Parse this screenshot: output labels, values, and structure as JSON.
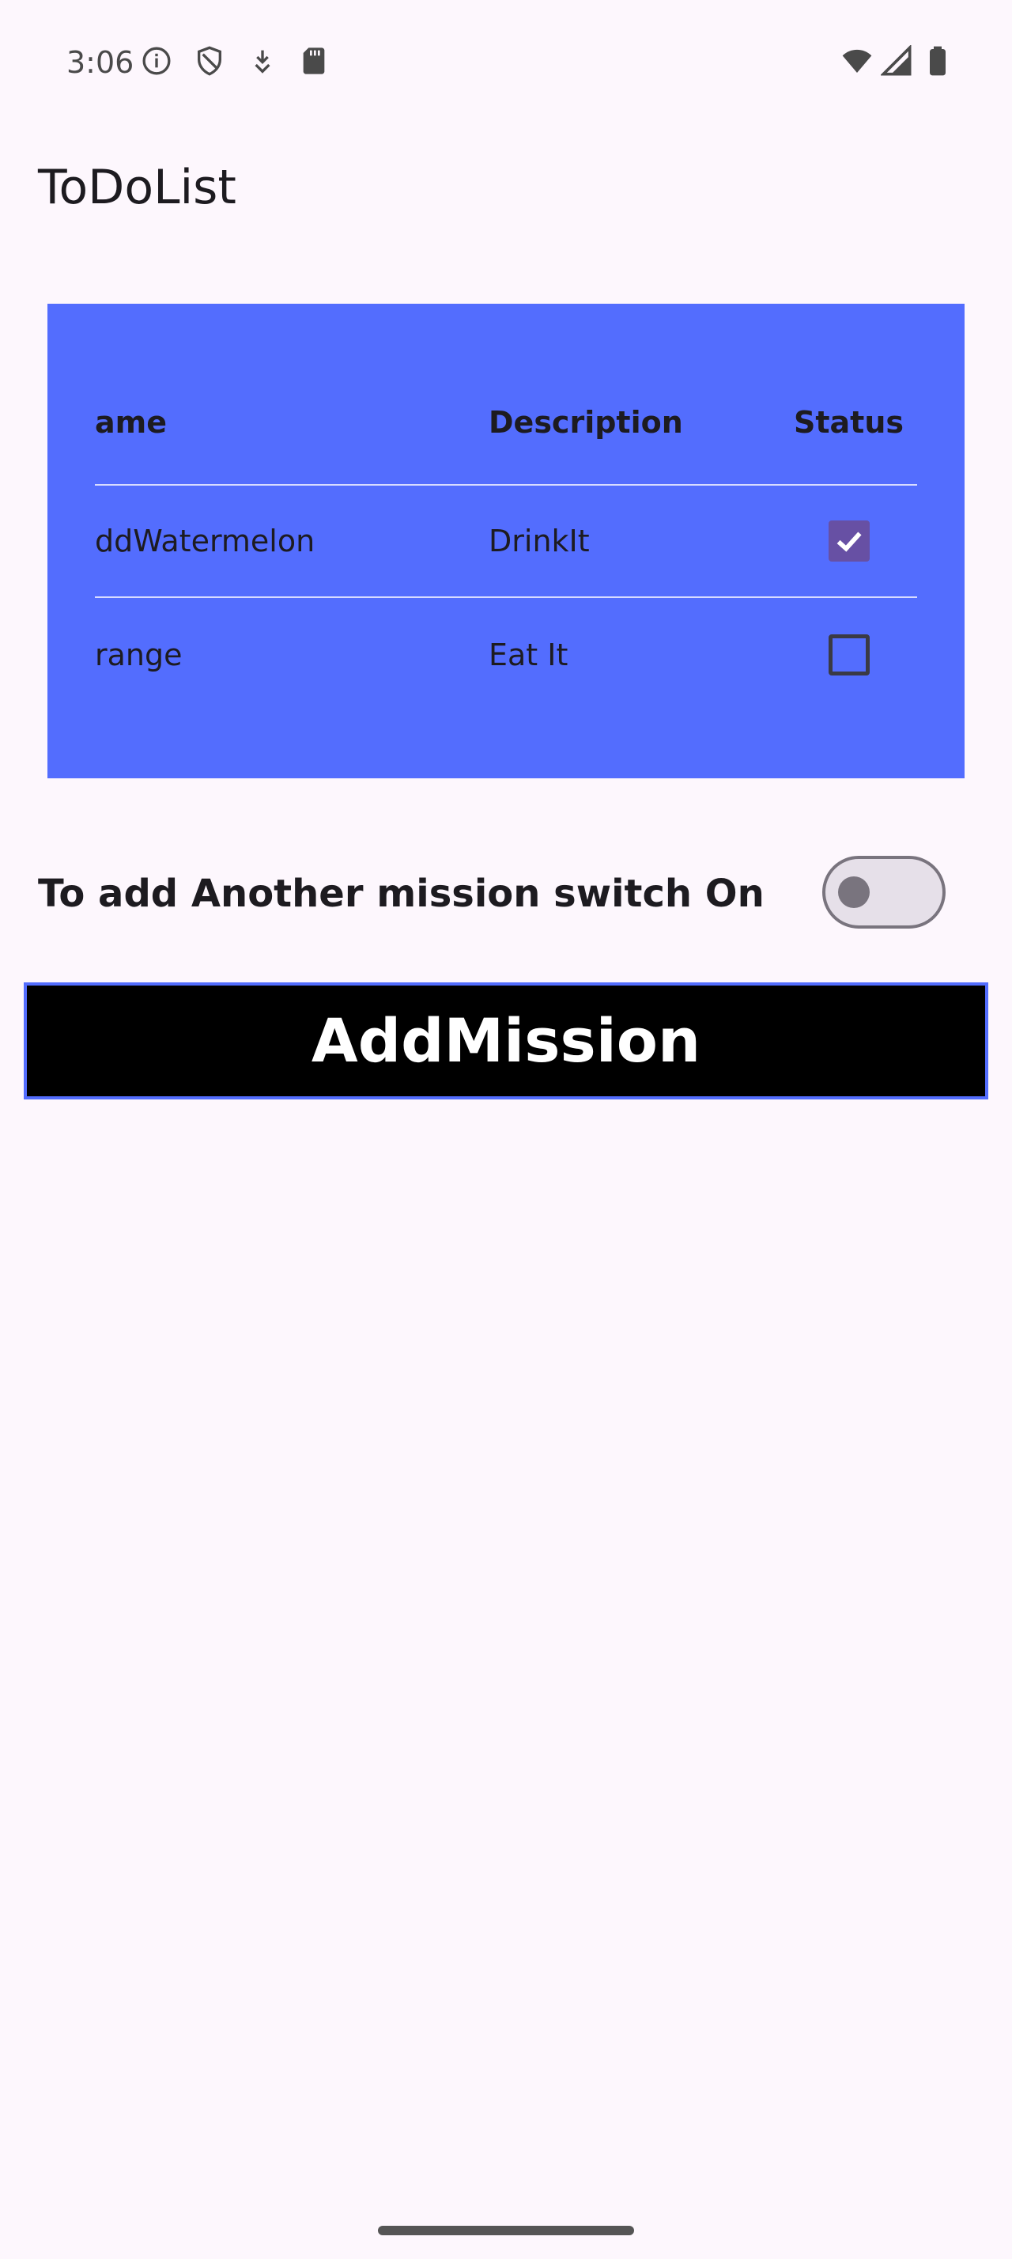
{
  "status_bar": {
    "time": "3:06",
    "icons_left": [
      "info-icon",
      "shield-icon",
      "download-icon",
      "sd-card-icon"
    ],
    "icons_right": [
      "wifi-icon",
      "signal-icon",
      "battery-icon"
    ]
  },
  "app_bar": {
    "title": "ToDoList"
  },
  "table": {
    "background_color": "#536dfe",
    "headers": {
      "name": "ame",
      "description": "Description",
      "status": "Status"
    },
    "rows": [
      {
        "name": "ddWatermelon",
        "description": "DrinkIt",
        "status": "checked"
      },
      {
        "name": "range",
        "description": "Eat It",
        "status": "unchecked"
      }
    ]
  },
  "switch_row": {
    "label": "To add Another mission switch On",
    "state": "off"
  },
  "add_button": {
    "label": "AddMission",
    "background_color": "#000000",
    "border_color": "#536dfe"
  },
  "colors": {
    "checkbox_checked": "#6750a4",
    "page_background": "#fdf7fd"
  }
}
